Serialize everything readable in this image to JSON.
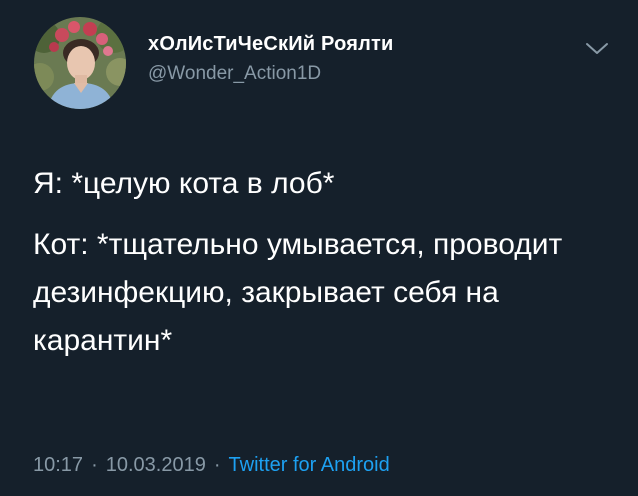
{
  "author": {
    "display_name": "хОлИсТиЧеСкИй Роялти",
    "handle": "@Wonder_Action1D"
  },
  "tweet": {
    "line1": "Я: *целую кота в лоб*",
    "line2": "Кот: *тщательно умывается, проводит дезинфекцию, закрывает себя на карантин*"
  },
  "meta": {
    "time": "10:17",
    "separator1": "·",
    "date": "10.03.2019",
    "separator2": "·",
    "source": "Twitter for Android"
  },
  "icons": {
    "menu": "chevron-down-icon",
    "avatar": "profile-photo"
  },
  "colors": {
    "background": "#15202b",
    "primary_text": "#ffffff",
    "secondary_text": "#8899a6",
    "link": "#1da1f2"
  }
}
